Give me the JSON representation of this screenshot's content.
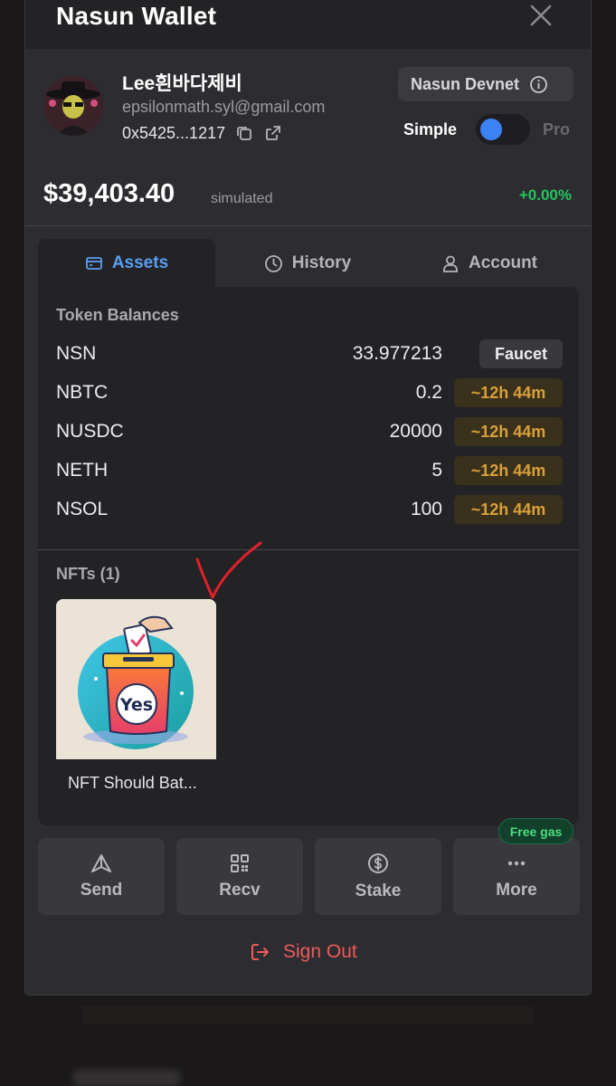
{
  "app": {
    "title": "Nasun Wallet"
  },
  "user": {
    "name": "Lee흰바다제비",
    "email": "epsilonmath.syl@gmail.com",
    "address": "0x5425...1217"
  },
  "network": {
    "label": "Nasun Devnet"
  },
  "mode": {
    "simple_label": "Simple",
    "pro_label": "Pro",
    "selected": "Simple"
  },
  "balance": {
    "amount": "$39,403.40",
    "note": "simulated",
    "change": "+0.00%"
  },
  "tabs": [
    {
      "label": "Assets",
      "icon": "card-icon",
      "active": true
    },
    {
      "label": "History",
      "icon": "clock-icon",
      "active": false
    },
    {
      "label": "Account",
      "icon": "user-icon",
      "active": false
    }
  ],
  "tokens": {
    "title": "Token Balances",
    "rows": [
      {
        "symbol": "NSN",
        "amount": "33.977213",
        "action": "Faucet"
      },
      {
        "symbol": "NBTC",
        "amount": "0.2",
        "action": "~12h 44m"
      },
      {
        "symbol": "NUSDC",
        "amount": "20000",
        "action": "~12h 44m"
      },
      {
        "symbol": "NETH",
        "amount": "5",
        "action": "~12h 44m"
      },
      {
        "symbol": "NSOL",
        "amount": "100",
        "action": "~12h 44m"
      }
    ]
  },
  "nfts": {
    "title": "NFTs (1)",
    "items": [
      {
        "name": "NFT Should Bat...",
        "image_text": "Yes"
      }
    ]
  },
  "actions": [
    {
      "label": "Send",
      "icon": "send-icon"
    },
    {
      "label": "Recv",
      "icon": "qr-icon"
    },
    {
      "label": "Stake",
      "icon": "dollar-icon"
    },
    {
      "label": "More",
      "icon": "more-icon"
    }
  ],
  "badges": {
    "free_gas": "Free gas"
  },
  "signout": {
    "label": "Sign Out"
  },
  "colors": {
    "accent": "#3b82f6",
    "positive": "#22c55e",
    "danger": "#ef5a5a",
    "timer": "#d9a03a"
  }
}
